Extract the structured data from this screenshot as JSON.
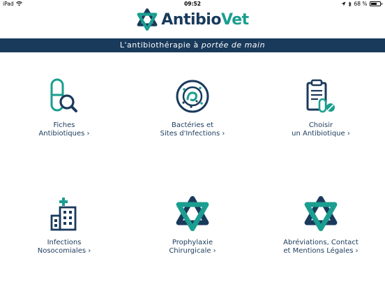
{
  "status": {
    "device": "iPad",
    "time": "09:52",
    "battery": "68 %",
    "battery_level": 0.68
  },
  "logo": {
    "name_part1": "Antibio",
    "name_part2": "Vet"
  },
  "banner": {
    "part1": "L'antibiothérapie à ",
    "part2": "portée de main"
  },
  "colors": {
    "navy": "#1a3a5c",
    "teal": "#1a9e8f"
  },
  "tiles": [
    {
      "line1": "Fiches",
      "line2": "Antibiotiques ›",
      "icon": "pill-search-icon"
    },
    {
      "line1": "Bactéries et",
      "line2": "Sites d'Infections ›",
      "icon": "bacteria-icon"
    },
    {
      "line1": "Choisir",
      "line2": "un Antibiotique ›",
      "icon": "clipboard-pills-icon"
    },
    {
      "line1": "Infections",
      "line2": "Nosocomiales ›",
      "icon": "hospital-icon"
    },
    {
      "line1": "Prophylaxie",
      "line2": "Chirurgicale ›",
      "icon": "antibiovet-star-icon"
    },
    {
      "line1": "Abréviations, Contact",
      "line2": "et Mentions Légales ›",
      "icon": "antibiovet-star-icon"
    }
  ]
}
